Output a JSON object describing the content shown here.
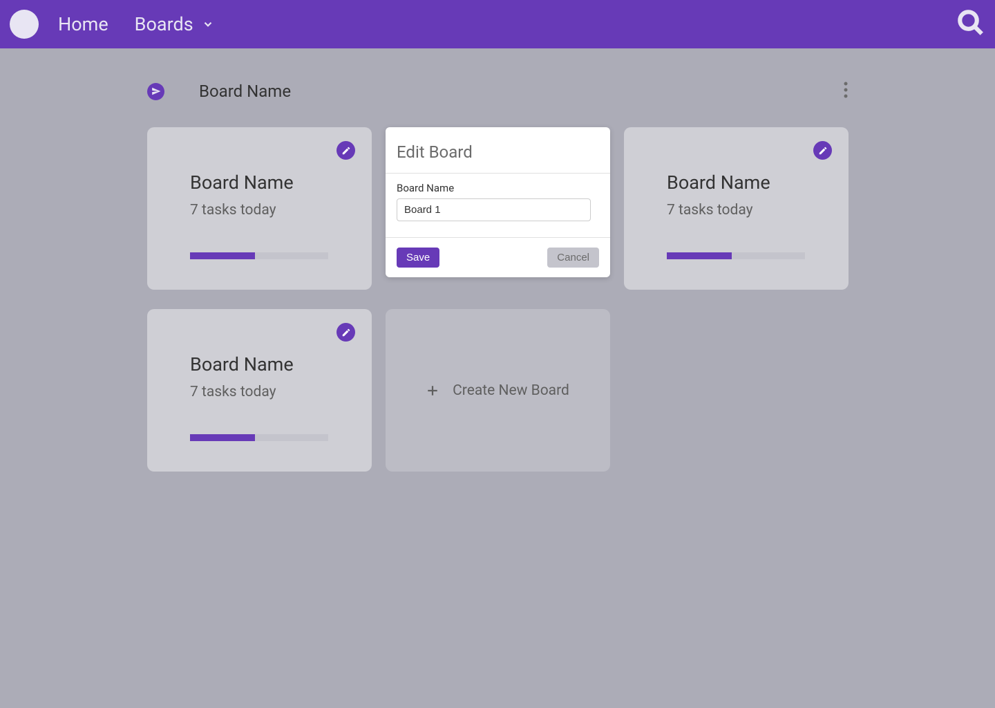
{
  "nav": {
    "home": "Home",
    "boards": "Boards"
  },
  "board_header": {
    "title": "Board Name"
  },
  "cards": [
    {
      "title": "Board Name",
      "subtitle": "7 tasks today",
      "progress": 47
    },
    {
      "title": "Board Name",
      "subtitle": "7 tasks today",
      "progress": 47
    },
    {
      "title": "Board Name",
      "subtitle": "7 tasks today",
      "progress": 47
    }
  ],
  "edit_modal": {
    "title": "Edit Board",
    "field_label": "Board Name",
    "field_value": "Board 1",
    "save_label": "Save",
    "cancel_label": "Cancel"
  },
  "create_card": {
    "label": "Create New Board"
  },
  "colors": {
    "primary": "#673ab7"
  }
}
